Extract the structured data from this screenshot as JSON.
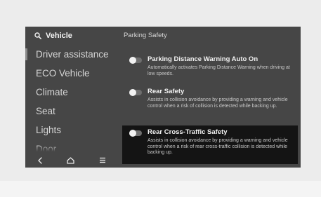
{
  "sidebar": {
    "search_label": "Vehicle",
    "search_icon": "search-icon",
    "items": [
      {
        "label": "Driver assistance"
      },
      {
        "label": "ECO Vehicle"
      },
      {
        "label": "Climate"
      },
      {
        "label": "Seat"
      },
      {
        "label": "Lights"
      },
      {
        "label": "Door"
      }
    ],
    "nav": [
      {
        "icon": "back-icon"
      },
      {
        "icon": "home-icon"
      },
      {
        "icon": "menu-icon"
      }
    ]
  },
  "content": {
    "section_title": "Parking Safety",
    "settings": [
      {
        "title": "Parking Distance Warning Auto On",
        "description": "Automatically activates Parking Distance Warning when driving at low speeds.",
        "enabled": false
      },
      {
        "title": "Rear Safety",
        "description": "Assists in collision avoidance by providing a warning and vehicle control when a risk of collision is detected while backing up.",
        "enabled": false
      },
      {
        "title": "Rear Cross-Traffic Safety",
        "description": "Assists in collision avoidance by providing a warning and vehicle control when a risk of rear cross-traffic collision is detected while backing up.",
        "enabled": false,
        "selected": true
      }
    ]
  },
  "colors": {
    "screen_background": "#464646",
    "selected_row_background": "#141414",
    "page_background": "#ececec"
  }
}
